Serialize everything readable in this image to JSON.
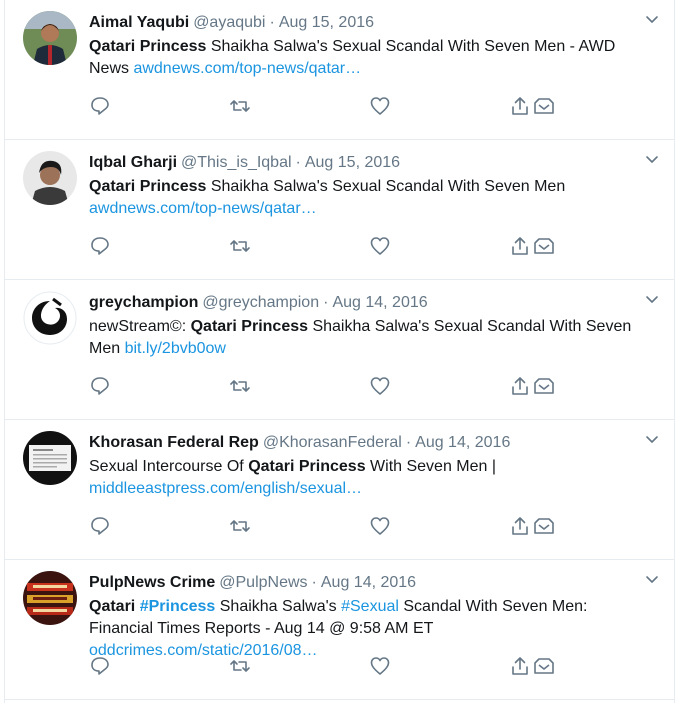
{
  "colors": {
    "text": "#14171a",
    "muted": "#657786",
    "link": "#1b95e0",
    "border": "#e6ecf0",
    "icon": "#657786"
  },
  "tweets": [
    {
      "name": "Aimal Yaqubi",
      "handle": "@ayaqubi",
      "sep": "·",
      "date": "Aug 15, 2016",
      "bold": "Qatari Princess",
      "text1": " Shaikha Salwa's Sexual Scandal With Seven Men - AWD News ",
      "link": "awdnews.com/top-news/qatar…",
      "avatar": "person-photo"
    },
    {
      "name": "Iqbal Gharji",
      "handle": "@This_is_Iqbal",
      "sep": "·",
      "date": "Aug 15, 2016",
      "bold": "Qatari Princess",
      "text1": " Shaikha Salwa's Sexual Scandal With Seven Men ",
      "link": "awdnews.com/top-news/qatar…",
      "avatar": "person-photo"
    },
    {
      "name": "greychampion",
      "handle": "@greychampion",
      "sep": "·",
      "date": "Aug 14, 2016",
      "pre": "newStream©: ",
      "bold": "Qatari Princess",
      "text1": " Shaikha Salwa's Sexual Scandal With Seven Men ",
      "link": "bit.ly/2bvb0ow",
      "avatar": "black-swirl-logo"
    },
    {
      "name": "Khorasan Federal Rep",
      "handle": "@KhorasanFederal",
      "sep": "·",
      "date": "Aug 14, 2016",
      "pre": "Sexual Intercourse Of ",
      "bold": "Qatari Princess",
      "text1": " With Seven Men | ",
      "link": "middleeastpress.com/english/sexual…",
      "avatar": "document-thumbnail"
    },
    {
      "name": "PulpNews Crime",
      "handle": "@PulpNews",
      "sep": "·",
      "date": "Aug 14, 2016",
      "bold": "Qatari",
      "sp1": " ",
      "hashtag1": "#Princess",
      "mid": " Shaikha Salwa's ",
      "hashtag2": "#Sexual",
      "text1": " Scandal With Seven Men: Financial Times Reports - Aug 14 @ 9:58 AM ET  ",
      "link": "oddcrimes.com/static/2016/08…",
      "avatar": "red-sign-logo"
    }
  ]
}
